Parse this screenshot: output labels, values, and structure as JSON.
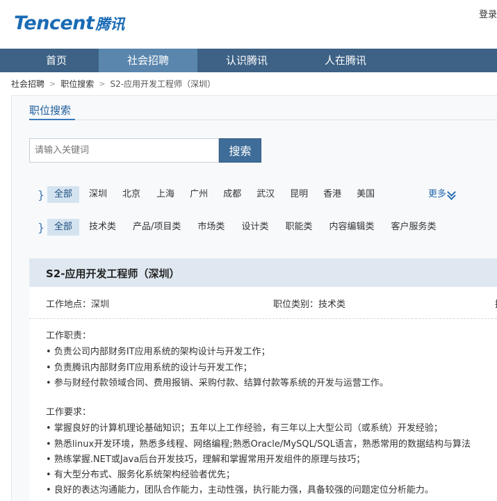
{
  "header": {
    "logo_en": "Tencent",
    "logo_cn": "腾讯",
    "login": "登录"
  },
  "nav": {
    "items": [
      {
        "label": "首页"
      },
      {
        "label": "社会招聘"
      },
      {
        "label": "认识腾讯"
      },
      {
        "label": "人在腾讯"
      }
    ]
  },
  "breadcrumb": {
    "items": [
      "社会招聘",
      "职位搜索"
    ],
    "current": "S2-应用开发工程师（深圳）"
  },
  "search": {
    "title": "职位搜索",
    "placeholder": "请输入关键词",
    "button": "搜索"
  },
  "filters": {
    "cities": [
      "全部",
      "深圳",
      "北京",
      "上海",
      "广州",
      "成都",
      "武汉",
      "昆明",
      "香港",
      "美国"
    ],
    "more": "更多",
    "categories": [
      "全部",
      "技术类",
      "产品/项目类",
      "市场类",
      "设计类",
      "职能类",
      "内容编辑类",
      "客户服务类"
    ]
  },
  "job": {
    "title": "S2-应用开发工程师（深圳）",
    "location": "工作地点：深圳",
    "category": "职位类别：技术类",
    "edge_text": "招",
    "duties_title": "工作职责：",
    "duties": [
      "负责公司内部财务IT应用系统的架构设计与开发工作；",
      "负责腾讯内部财务IT应用系统的设计与开发工作；",
      "参与财经付款领域合同、费用报销、采购付款、结算付款等系统的开发与运营工作。"
    ],
    "requirements_title": "工作要求：",
    "requirements": [
      "掌握良好的计算机理论基础知识；五年以上工作经验，有三年以上大型公司（或系统）开发经验；",
      "熟悉linux开发环境，熟悉多线程、网络编程;熟悉Oracle/MySQL/SQL语言，熟悉常用的数据结构与算法",
      "熟练掌握.NET或Java后台开发技巧，理解和掌握常用开发组件的原理与技巧；",
      "有大型分布式、服务化系统架构经验者优先；",
      "良好的表达沟通能力，团队合作能力，主动性强，执行能力强，具备较强的问题定位分析能力。"
    ]
  }
}
